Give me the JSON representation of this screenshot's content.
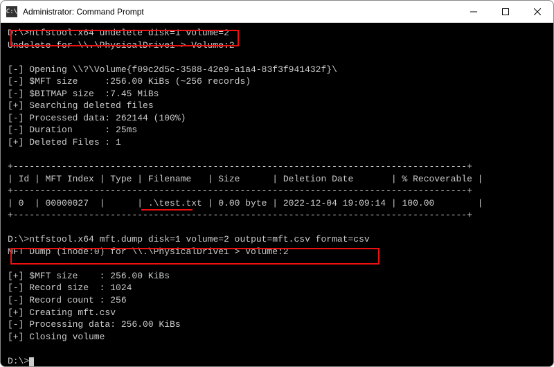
{
  "window": {
    "title": "Administrator: Command Prompt",
    "icon_label": "cmd-icon"
  },
  "prompt1": {
    "prefix": "D:\\>",
    "command": "ntfstool.x64 undelete disk=1 volume=2"
  },
  "undelete_header": "Undelete for \\\\.\\PhysicalDrive1 > Volume:2",
  "section1_lines": [
    "[-] Opening \\\\?\\Volume{f09c2d5c-3588-42e9-a1a4-83f3f941432f}\\",
    "[-] $MFT size     :256.00 KiBs (~256 records)",
    "[-] $BITMAP size  :7.45 MiBs",
    "[+] Searching deleted files",
    "[-] Processed data: 262144 (100%)",
    "[-] Duration      : 25ms",
    "[+] Deleted Files : 1"
  ],
  "table": {
    "rule": "+------------------------------------------------------------------------------------+",
    "header": "| Id | MFT Index | Type | Filename   | Size      | Deletion Date       | % Recoverable |",
    "row": "| 0  | 00000027  |      | .\\test.txt | 0.00 byte | 2022-12-04 19:09:14 | 100.00        |"
  },
  "prompt2": {
    "prefix": "D:\\>",
    "command": "ntfstool.x64 mft.dump disk=1 volume=2 output=mft.csv format=csv"
  },
  "mftdump_header": "MFT Dump (inode:0) for \\\\.\\PhysicalDrive1 > Volume:2",
  "section2_lines": [
    "[+] $MFT size    : 256.00 KiBs",
    "[-] Record size  : 1024",
    "[-] Record count : 256",
    "[+] Creating mft.csv",
    "[-] Processing data: 256.00 KiBs",
    "[+] Closing volume"
  ],
  "prompt3": "D:\\>",
  "chart_data": {
    "type": "table",
    "columns": [
      "Id",
      "MFT Index",
      "Type",
      "Filename",
      "Size",
      "Deletion Date",
      "% Recoverable"
    ],
    "rows": [
      [
        "0",
        "00000027",
        "",
        ".\\test.txt",
        "0.00 byte",
        "2022-12-04 19:09:14",
        "100.00"
      ]
    ]
  }
}
